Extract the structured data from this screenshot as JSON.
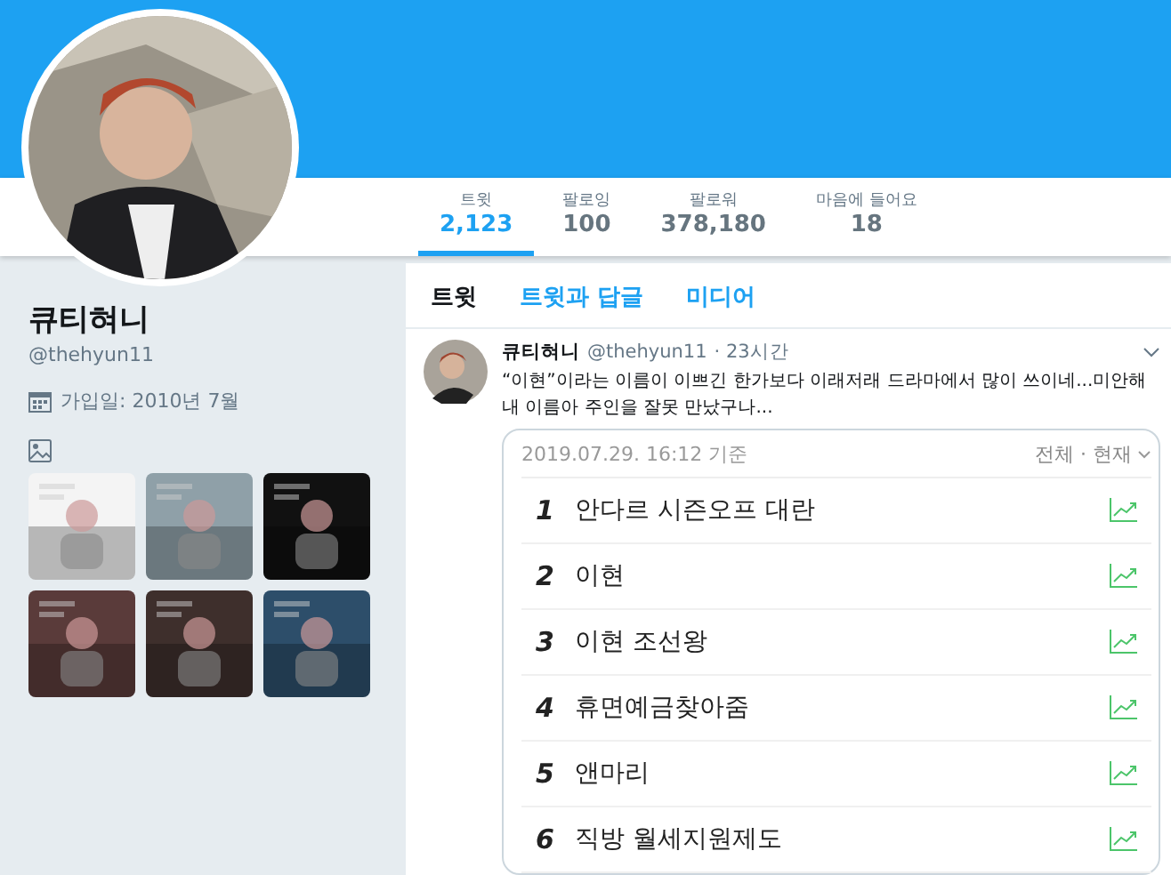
{
  "profile": {
    "name": "큐티혀니",
    "handle": "@thehyun11",
    "joined": "가입일: 2010년 7월"
  },
  "stats": [
    {
      "label": "트윗",
      "value": "2,123",
      "selected": true
    },
    {
      "label": "팔로잉",
      "value": "100",
      "selected": false
    },
    {
      "label": "팔로워",
      "value": "378,180",
      "selected": false
    },
    {
      "label": "마음에 들어요",
      "value": "18",
      "selected": false
    }
  ],
  "timeline_tabs": [
    {
      "label": "트윗",
      "selected": true
    },
    {
      "label": "트윗과 답글",
      "selected": false
    },
    {
      "label": "미디어",
      "selected": false
    }
  ],
  "tweet": {
    "name": "큐티혀니",
    "handle": "@thehyun11",
    "time": "· 23시간",
    "text": "“이현”이라는 이름이 이쁘긴 한가보다 이래저래 드라마에서 많이 쓰이네...미안해 내 이름아 주인을 잘못 만났구나...",
    "card": {
      "timestamp": "2019.07.29. 16:12 기준",
      "filter": "전체 · 현재",
      "rows": [
        {
          "rank": "1",
          "term": "안다르 시즌오프 대란"
        },
        {
          "rank": "2",
          "term": "이현"
        },
        {
          "rank": "3",
          "term": "이현 조선왕"
        },
        {
          "rank": "4",
          "term": "휴면예금찾아줌"
        },
        {
          "rank": "5",
          "term": "앤마리"
        },
        {
          "rank": "6",
          "term": "직방 월세지원제도"
        }
      ]
    }
  }
}
